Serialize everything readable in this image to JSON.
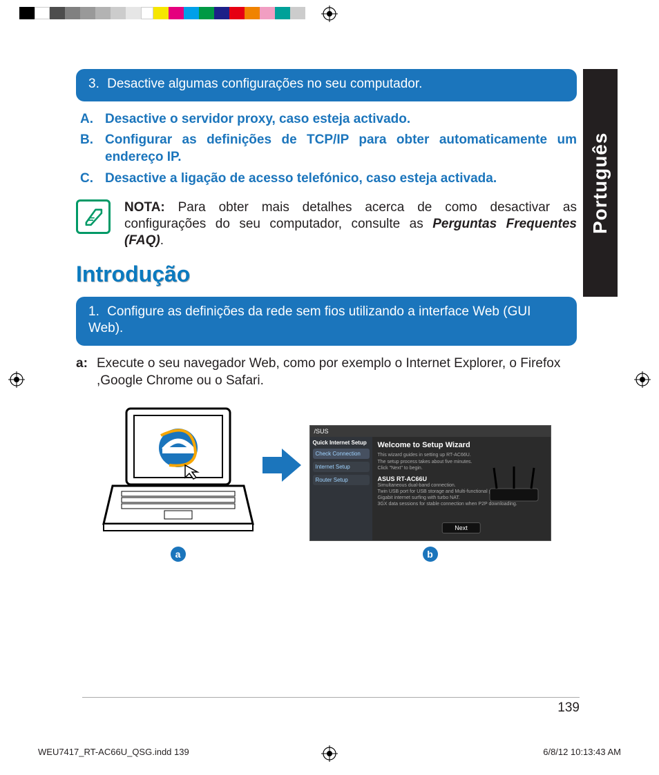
{
  "color_swatches": [
    {
      "w": 22,
      "c": "#000000"
    },
    {
      "w": 22,
      "c": "#ffffff"
    },
    {
      "w": 22,
      "c": "#4d4d4d"
    },
    {
      "w": 22,
      "c": "#808080"
    },
    {
      "w": 22,
      "c": "#999999"
    },
    {
      "w": 22,
      "c": "#b3b3b3"
    },
    {
      "w": 22,
      "c": "#cccccc"
    },
    {
      "w": 22,
      "c": "#e6e6e6"
    },
    {
      "w": 18,
      "c": "#ffffff"
    },
    {
      "w": 22,
      "c": "#f6e600"
    },
    {
      "w": 22,
      "c": "#e5007e"
    },
    {
      "w": 22,
      "c": "#00a0e9"
    },
    {
      "w": 22,
      "c": "#009944"
    },
    {
      "w": 22,
      "c": "#1d2088"
    },
    {
      "w": 22,
      "c": "#e60012"
    },
    {
      "w": 22,
      "c": "#f08300"
    },
    {
      "w": 22,
      "c": "#f19ec2"
    },
    {
      "w": 22,
      "c": "#00a199"
    },
    {
      "w": 22,
      "c": "#cccccc"
    }
  ],
  "side_tab": "Português",
  "bar3": {
    "num": "3.",
    "text": "Desactive algumas configurações no seu computador."
  },
  "abc": [
    {
      "l": "A.",
      "t": "Desactive o servidor proxy, caso esteja activado."
    },
    {
      "l": "B.",
      "t": "Configurar as definições de TCP/IP para obter automaticamente um endereço IP."
    },
    {
      "l": "C.",
      "t": "Desactive a ligação de acesso telefónico, caso esteja activada."
    }
  ],
  "note": {
    "label": "NOTA:",
    "body": "Para obter mais detalhes acerca de como desactivar as configurações do seu computador, consulte as ",
    "bold": "Perguntas Frequentes (FAQ)",
    "tail": "."
  },
  "section_title": "Introdução",
  "bar1": {
    "num": "1.",
    "text": "Configure as definições da rede sem fios utilizando a interface Web (GUI Web)."
  },
  "step_a": {
    "l": "a:",
    "t": "Execute o seu navegador Web, como por exemplo o Internet Explorer, o Firefox ,Google Chrome ou o Safari."
  },
  "wizard": {
    "brand": "/SUS",
    "window_title": "Welcome to Setup Wizard",
    "side_title": "Quick Internet Setup",
    "side_items": [
      "Check Connection",
      "Internet Setup",
      "Router Setup"
    ],
    "intro1": "This wizard guides in setting up RT-AC66U.",
    "intro2": "The setup process takes about five minutes.",
    "intro3": "Click \"Next\" to begin.",
    "product": "ASUS RT-AC66U",
    "feat1": "Simultaneous dual-band connection.",
    "feat2": "Twin USB port for USB storage and Multi-functional printer.",
    "feat3": "Gigabit internet surfing with turbo NAT.",
    "feat4": "3GX data sessions for stable connection when P2P downloading.",
    "next": "Next"
  },
  "labels": {
    "a": "a",
    "b": "b"
  },
  "page_number": "139",
  "slug_left": "WEU7417_RT-AC66U_QSG.indd   139",
  "slug_right": "6/8/12   10:13:43 AM"
}
